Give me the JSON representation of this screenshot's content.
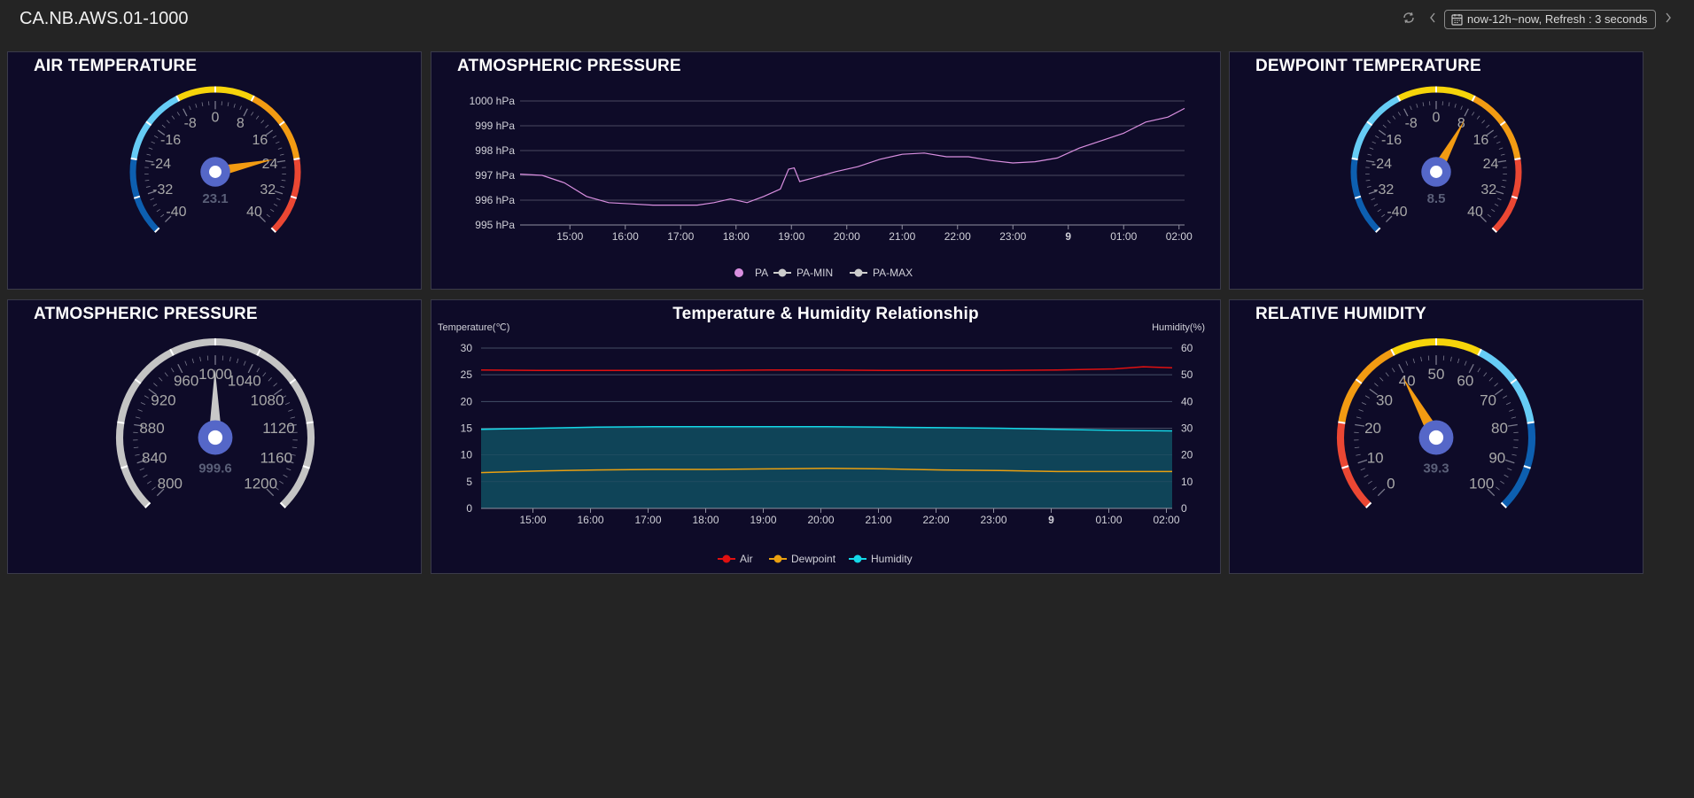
{
  "header": {
    "title": "CA.NB.AWS.01-1000",
    "time_range": "now-12h~now, Refresh : 3 seconds",
    "refresh_icon": "refresh-icon",
    "prev_icon": "chevron-left-icon",
    "next_icon": "chevron-right-icon",
    "calendar_icon": "calendar-icon"
  },
  "colors": {
    "page_bg": "#242424",
    "panel_bg": "#0e0b28",
    "gauge_blue_dark": "#0d5fb0",
    "gauge_blue_light": "#66ccf5",
    "gauge_yellow": "#f6d40a",
    "gauge_orange": "#f29b12",
    "gauge_red": "#eb4733",
    "gauge_grey": "#c4c4c4",
    "pressure_line": "#d98fe0",
    "air": "#e01010",
    "dewpoint": "#eaa010",
    "humidity": "#14d8e8",
    "hub": "#5567c8"
  },
  "gauges": {
    "air_temperature": {
      "title": "AIR TEMPERATURE",
      "ticks": [
        "-40",
        "-32",
        "-24",
        "-16",
        "-8",
        "0",
        "8",
        "16",
        "24",
        "32",
        "40"
      ],
      "min": -40,
      "max": 40,
      "value": 23.1,
      "value_text": "23.1"
    },
    "dewpoint_temperature": {
      "title": "DEWPOINT TEMPERATURE",
      "ticks": [
        "-40",
        "-32",
        "-24",
        "-16",
        "-8",
        "0",
        "8",
        "16",
        "24",
        "32",
        "40"
      ],
      "min": -40,
      "max": 40,
      "value": 8.5,
      "value_text": "8.5"
    },
    "atmospheric_pressure": {
      "title": "ATMOSPHERIC PRESSURE",
      "ticks": [
        "800",
        "840",
        "880",
        "920",
        "960",
        "1000",
        "1040",
        "1080",
        "1120",
        "1160",
        "1200"
      ],
      "min": 800,
      "max": 1200,
      "value": 999.6,
      "value_text": "999.6"
    },
    "relative_humidity": {
      "title": "RELATIVE HUMIDITY",
      "ticks": [
        "0",
        "10",
        "20",
        "30",
        "40",
        "50",
        "60",
        "70",
        "80",
        "90",
        "100"
      ],
      "min": 0,
      "max": 100,
      "value": 39.3,
      "value_text": "39.3"
    }
  },
  "chart_data": [
    {
      "type": "line",
      "title": "ATMOSPHERIC PRESSURE",
      "x_ticks": [
        "15:00",
        "16:00",
        "17:00",
        "18:00",
        "19:00",
        "20:00",
        "21:00",
        "22:00",
        "23:00",
        "9",
        "01:00",
        "02:00"
      ],
      "y_ticks": [
        "995 hPa",
        "996 hPa",
        "997 hPa",
        "998 hPa",
        "999 hPa",
        "1000 hPa"
      ],
      "ylim": [
        995,
        1000
      ],
      "x_range_hours": [
        14.1,
        26.1
      ],
      "legend": [
        "PA",
        "PA-MIN",
        "PA-MAX"
      ],
      "series": [
        {
          "name": "PA",
          "x": [
            14.1,
            14.5,
            14.9,
            15.3,
            15.7,
            16.1,
            16.5,
            16.9,
            17.3,
            17.6,
            17.9,
            18.2,
            18.5,
            18.8,
            18.95,
            19.05,
            19.15,
            19.4,
            19.8,
            20.2,
            20.6,
            21.0,
            21.4,
            21.8,
            22.2,
            22.6,
            23.0,
            23.4,
            23.8,
            24.2,
            24.6,
            25.0,
            25.4,
            25.8,
            26.1
          ],
          "values": [
            997.05,
            997.0,
            996.7,
            996.15,
            995.9,
            995.85,
            995.8,
            995.8,
            995.8,
            995.9,
            996.05,
            995.9,
            996.15,
            996.45,
            997.25,
            997.3,
            996.75,
            996.9,
            997.15,
            997.35,
            997.65,
            997.85,
            997.9,
            997.75,
            997.75,
            997.6,
            997.5,
            997.55,
            997.7,
            998.1,
            998.4,
            998.7,
            999.15,
            999.35,
            999.7
          ]
        }
      ]
    },
    {
      "type": "area",
      "title": "Temperature & Humidity Relationship",
      "ylabel": "Temperature(℃)",
      "y2label": "Humidity(%)",
      "x_ticks": [
        "15:00",
        "16:00",
        "17:00",
        "18:00",
        "19:00",
        "20:00",
        "21:00",
        "22:00",
        "23:00",
        "9",
        "01:00",
        "02:00"
      ],
      "y_ticks": [
        "0",
        "5",
        "10",
        "15",
        "20",
        "25",
        "30"
      ],
      "y2_ticks": [
        "0",
        "10",
        "20",
        "30",
        "40",
        "50",
        "60"
      ],
      "ylim": [
        0,
        30
      ],
      "y2lim": [
        0,
        60
      ],
      "x_range_hours": [
        14.1,
        26.1
      ],
      "legend": [
        "Air",
        "Dewpoint",
        "Humidity"
      ],
      "series": [
        {
          "name": "Air",
          "x": [
            14.1,
            15.1,
            16.1,
            17.1,
            18.1,
            19.1,
            20.1,
            21.1,
            22.1,
            23.1,
            24.1,
            25.1,
            25.6,
            26.1
          ],
          "values": [
            25.9,
            25.8,
            25.8,
            25.8,
            25.8,
            25.9,
            25.9,
            25.8,
            25.8,
            25.8,
            25.9,
            26.1,
            26.5,
            26.3
          ]
        },
        {
          "name": "Dewpoint",
          "x": [
            14.1,
            15.1,
            16.1,
            17.1,
            18.1,
            19.1,
            20.1,
            21.1,
            22.1,
            23.1,
            24.1,
            25.1,
            26.1
          ],
          "values": [
            6.7,
            7.0,
            7.2,
            7.3,
            7.3,
            7.4,
            7.5,
            7.4,
            7.2,
            7.1,
            6.9,
            6.9,
            6.9
          ]
        },
        {
          "name": "Humidity",
          "axis": "right",
          "x": [
            14.1,
            15.1,
            16.1,
            17.1,
            18.1,
            19.1,
            20.1,
            21.1,
            22.1,
            23.1,
            24.1,
            25.1,
            26.1
          ],
          "values": [
            29.6,
            30.0,
            30.4,
            30.6,
            30.6,
            30.6,
            30.6,
            30.4,
            30.2,
            30.0,
            29.6,
            29.2,
            29.0
          ]
        }
      ]
    }
  ]
}
